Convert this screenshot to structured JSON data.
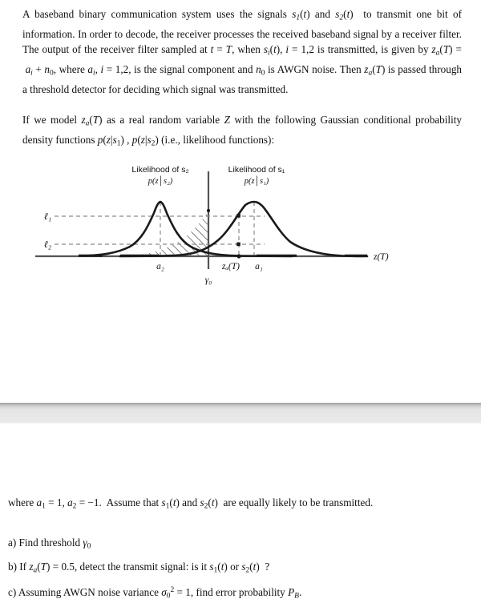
{
  "document": {
    "paragraphs": {
      "intro": "A baseband binary communication system uses the signals s₁(t) and s₂(t) to transmit one bit of information. In order to decode, the receiver processes the received baseband signal by a receiver filter. The output of the receiver filter sampled at t = T, when sᵢ(t), i = 1,2 is transmitted, is given by zₐ(T) = aᵢ + n₀, where aᵢ, i = 1,2, is the signal component and n₀ is AWGN noise. Then zₐ(T) is passed through a threshold detector for deciding which signal was transmitted.",
      "model": "If we model zₐ(T) as a real random variable Z with the following Gaussian conditional probability density functions p(z|s₁) , p(z|s₂) (i.e., likelihood functions):",
      "where": "where a₁ = 1, a₂ = −1.  Assume that s₁(t) and s₂(t) are equally likely to be transmitted.",
      "item_a": "a) Find threshold γ₀",
      "item_b": "b) If zₐ(T) = 0.5, detect the transmit signal: is it s₁(t) or s₂(t) ?",
      "item_c": "c) Assuming AWGN noise variance σ₀² = 1, find error probability P_B."
    }
  },
  "figure": {
    "caption_left_line1": "Likelihood of s₂",
    "caption_left_line2": "p(z│s₂)",
    "caption_right_line1": "Likelihood of s₁",
    "caption_right_line2": "p(z│s₁)",
    "y_label_upper": "ℓ₁",
    "y_label_lower": "ℓ₂",
    "x_label_a2": "a₂",
    "x_label_za": "zₐ(T)",
    "x_label_a1": "a₁",
    "x_label_threshold": "γ₀",
    "axis_label_x": "z(T)",
    "colors": {
      "curve": "#1a1a1a",
      "axis": "#4d4d4d",
      "dashed": "#7a7a7a",
      "hatch": "#1a1a1a"
    }
  },
  "chart_data": {
    "type": "line",
    "title": "Gaussian conditional likelihood functions",
    "xlabel": "z(T)",
    "ylabel": "",
    "grid": false,
    "legend_position": "above-curves",
    "x": [
      -4.0,
      -3.5,
      -3.0,
      -2.5,
      -2.0,
      -1.5,
      -1.0,
      -0.5,
      0.0,
      0.5,
      1.0,
      1.5,
      2.0,
      2.5,
      3.0,
      3.5,
      4.0
    ],
    "series": [
      {
        "name": "p(z|s2)",
        "mean": -1,
        "variance": 1,
        "peak_label": "a₂",
        "values": [
          0.0044,
          0.0175,
          0.054,
          0.1295,
          0.242,
          0.3521,
          0.3989,
          0.3521,
          0.242,
          0.1295,
          0.054,
          0.0175,
          0.0044,
          0.0009,
          0.0001,
          0.0,
          0.0
        ]
      },
      {
        "name": "p(z|s1)",
        "mean": 1,
        "variance": 1,
        "peak_label": "a₁",
        "values": [
          0.0,
          0.0,
          0.0001,
          0.0009,
          0.0044,
          0.0175,
          0.054,
          0.1295,
          0.242,
          0.3521,
          0.3989,
          0.3521,
          0.242,
          0.1295,
          0.054,
          0.0175,
          0.0044
        ]
      }
    ],
    "markers": [
      {
        "name": "threshold",
        "label": "γ₀",
        "x": 0
      },
      {
        "name": "observation",
        "label": "zₐ(T)",
        "x": 0.5
      },
      {
        "name": "likelihood-upper",
        "label": "ℓ₁",
        "y": 0.3521
      },
      {
        "name": "likelihood-lower",
        "label": "ℓ₂",
        "y": 0.1295
      }
    ],
    "shaded_region": {
      "name": "error-probability-area",
      "hatched": true,
      "from_x": -1.9,
      "to_x": 0
    }
  }
}
